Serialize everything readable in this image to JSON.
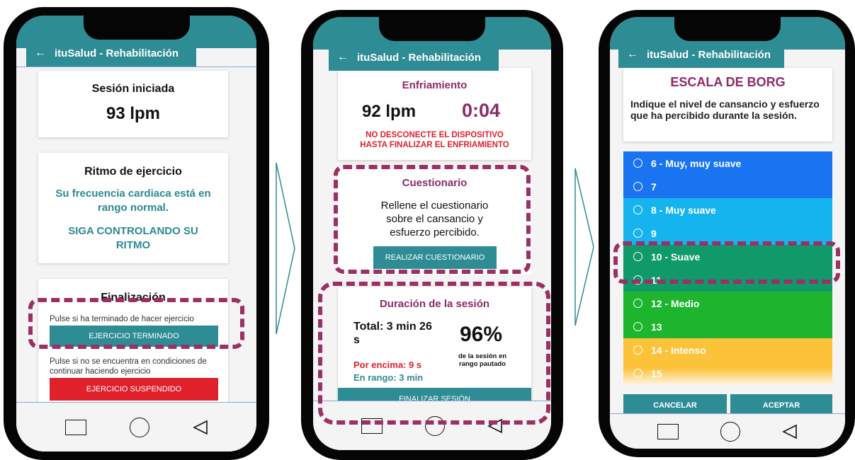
{
  "app": {
    "title": "ituSalud - Rehabilitación",
    "back_icon": "arrow-left-icon"
  },
  "screen1": {
    "session_title": "Sesión iniciada",
    "bpm": "93 lpm",
    "rhythm_title": "Ritmo de ejercicio",
    "rhythm_msg": "Su frecuencia cardiaca está en rango normal.",
    "rhythm_advice": "SIGA CONTROLANDO SU RITMO",
    "final_title": "Finalización",
    "finished_hint": "Pulse si ha terminado de hacer ejercicio",
    "finished_button": "EJERCICIO TERMINADO",
    "suspend_hint": "Pulse si no se encuentra en condiciones de continuar haciendo ejercicio",
    "suspend_button": "EJERCICIO SUSPENDIDO"
  },
  "screen2": {
    "cooldown_title": "Enfriamiento",
    "bpm": "92 lpm",
    "timer": "0:04",
    "warning": "NO DESCONECTE EL DISPOSITIVO HASTA FINALIZAR EL ENFRIAMIENTO",
    "quiz_title": "Cuestionario",
    "quiz_text": "Rellene el cuestionario sobre el cansancio y esfuerzo percibido.",
    "quiz_button": "REALIZAR CUESTIONARIO",
    "duration_title": "Duración de la sesión",
    "total": "Total: 3 min 26 s",
    "above": "Por encima: 9 s",
    "in_range": "En rango: 3 min",
    "percent": "96%",
    "percent_caption": "de la sesión en rango pautado",
    "finish_button": "FINALIZAR SESIÓN"
  },
  "screen3": {
    "title": "ESCALA DE BORG",
    "prompt": "Indique el nivel de cansancio y esfuerzo que ha percibido durante la sesión.",
    "options": [
      {
        "label": "6 - Muy, muy suave",
        "color": "#1a74f2"
      },
      {
        "label": "7",
        "color": "#1a74f2"
      },
      {
        "label": "8 - Muy suave",
        "color": "#15b4ee"
      },
      {
        "label": "9",
        "color": "#15b4ee"
      },
      {
        "label": "10 - Suave",
        "color": "#109a6a"
      },
      {
        "label": "11",
        "color": "#109a6a"
      },
      {
        "label": "12 - Medio",
        "color": "#1eb52e"
      },
      {
        "label": "13",
        "color": "#1eb52e"
      },
      {
        "label": "14 - Intenso",
        "color": "#fcc23a"
      },
      {
        "label": "15",
        "color": "#fcc23a"
      }
    ],
    "cancel": "CANCELAR",
    "accept": "ACEPTAR"
  },
  "colors": {
    "teal": "#2e8c95",
    "magenta": "#8e2a69",
    "red": "#e0202b",
    "highlight": "#9c2f63"
  }
}
